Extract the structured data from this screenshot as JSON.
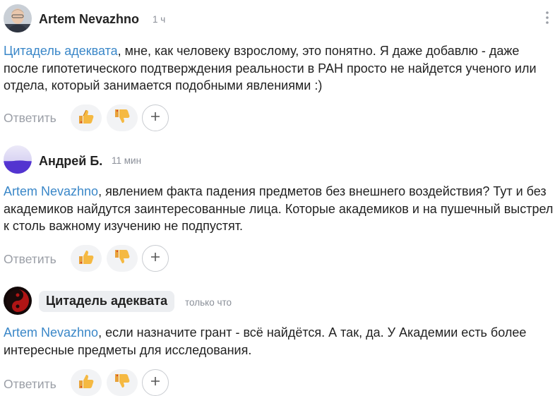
{
  "comments": [
    {
      "author": "Artem Nevazhno",
      "time": "1 ч",
      "mention": "Цитадель адеквата",
      "text": ", мне, как человеку взрослому, это понятно. Я даже добавлю - даже после гипотетического подтверждения реальности в РАН просто не найдется ученого или отдела, который занимается подобными явлениями :)",
      "reply_label": "Ответить",
      "avatar_icon": "person-photo-avatar"
    },
    {
      "author": "Андрей Б.",
      "time": "11 мин",
      "mention": "Artem Nevazhno",
      "text": ", явлением факта падения предметов без внешнего воздействия? Тут и без академиков найдутся заинтересованные лица. Которые академиков и на пушечный выстрел к столь важному изучению не подпустят.",
      "reply_label": "Ответить",
      "avatar_icon": "purple-gradient-avatar"
    },
    {
      "author": "Цитадель адеквата",
      "time": "только что",
      "mention": "Artem Nevazhno",
      "text": ", если назначите грант - всё найдётся. А так, да. У Академии есть более интересные предметы для исследования.",
      "reply_label": "Ответить",
      "avatar_icon": "yin-yang-avatar"
    }
  ],
  "colors": {
    "mention": "#3a87c8",
    "reply": "#9a9ea6",
    "reaction_bg": "#f2f3f5"
  },
  "icons": [
    "thumbs-up-icon",
    "thumbs-down-icon",
    "plus-icon",
    "more-vertical-icon"
  ]
}
